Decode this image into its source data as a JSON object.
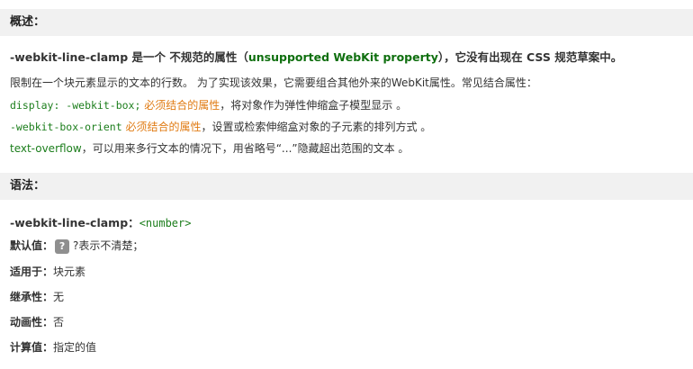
{
  "overview": {
    "header": "概述：",
    "title_prefix": "-webkit-line-clamp 是一个 不规范的属性（",
    "title_green": "unsupported WebKit property",
    "title_suffix": "），它没有出现在 CSS 规范草案中。",
    "description": "限制在一个块元素显示的文本的行数。 为了实现该效果，它需要组合其他外来的WebKit属性。常见结合属性：",
    "props": [
      {
        "code": "display: -webkit-box;",
        "note": "必须结合的属性",
        "rest": "，将对象作为弹性伸缩盒子模型显示 。"
      },
      {
        "code": "-webkit-box-orient",
        "note": "必须结合的属性",
        "rest": "，设置或检索伸缩盒对象的子元素的排列方式 。"
      },
      {
        "code": "text-overflow",
        "note": "",
        "rest": "，可以用来多行文本的情况下，用省略号“...”隐藏超出范围的文本 。"
      }
    ]
  },
  "syntax": {
    "header": "语法：",
    "property": "-webkit-line-clamp",
    "separator": "：",
    "value": "<number>",
    "rows": {
      "default_label": "默认值：",
      "default_badge": "?",
      "default_value": "?表示不清楚；",
      "applies_label": "适用于：",
      "applies_value": "块元素",
      "inherit_label": "继承性：",
      "inherit_value": "无",
      "anim_label": "动画性：",
      "anim_value": "否",
      "computed_label": "计算值：",
      "computed_value": "指定的值"
    }
  }
}
